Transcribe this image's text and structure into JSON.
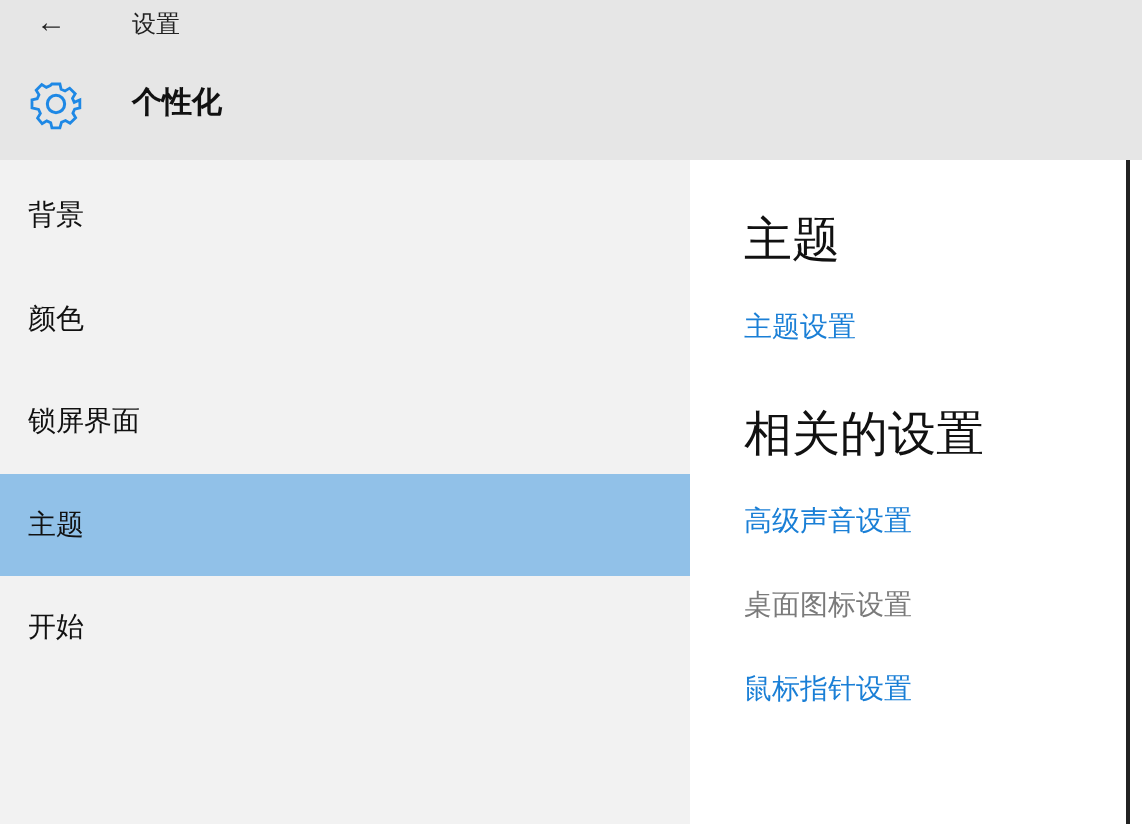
{
  "header": {
    "back": "←",
    "title": "设置",
    "section": "个性化"
  },
  "sidebar": {
    "items": [
      {
        "label": "背景",
        "selected": false
      },
      {
        "label": "颜色",
        "selected": false
      },
      {
        "label": "锁屏界面",
        "selected": false
      },
      {
        "label": "主题",
        "selected": true
      },
      {
        "label": "开始",
        "selected": false
      }
    ]
  },
  "content": {
    "groups": [
      {
        "heading": "主题",
        "links": [
          {
            "label": "主题设置",
            "disabled": false
          }
        ]
      },
      {
        "heading": "相关的设置",
        "links": [
          {
            "label": "高级声音设置",
            "disabled": false
          },
          {
            "label": "桌面图标设置",
            "disabled": true
          },
          {
            "label": "鼠标指针设置",
            "disabled": false
          }
        ]
      }
    ]
  }
}
